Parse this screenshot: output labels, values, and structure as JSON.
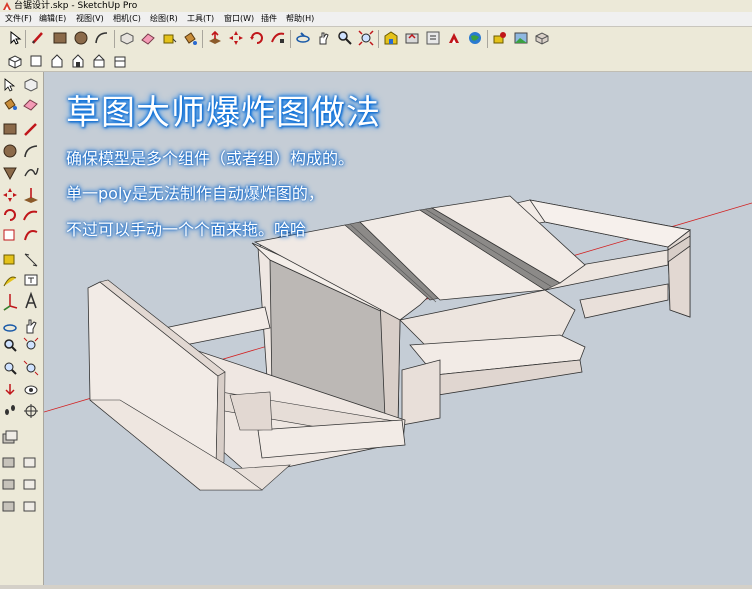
{
  "window": {
    "title": "台锯设计.skp - SketchUp Pro"
  },
  "menu": [
    "文件(F)",
    "编辑(E)",
    "视图(V)",
    "相机(C)",
    "绘图(R)",
    "工具(T)",
    "窗口(W)",
    "插件",
    "帮助(H)"
  ],
  "overlay": {
    "headline": "草图大师爆炸图做法",
    "lines": [
      "确保模型是多个组件（或者组）构成的。",
      "单一poly是无法制作自动爆炸图的，",
      "不过可以手动一个个面来拖。哈哈"
    ]
  },
  "colors": {
    "sky": "#c5cdd6",
    "ground": "#c5cdd6",
    "board_light": "#f2ebe6",
    "board_shadow": "#e2d8d2",
    "panel_grey": "#b9b5b2",
    "headline_glow": "#1e90ff",
    "axis_red": "#d22020"
  }
}
